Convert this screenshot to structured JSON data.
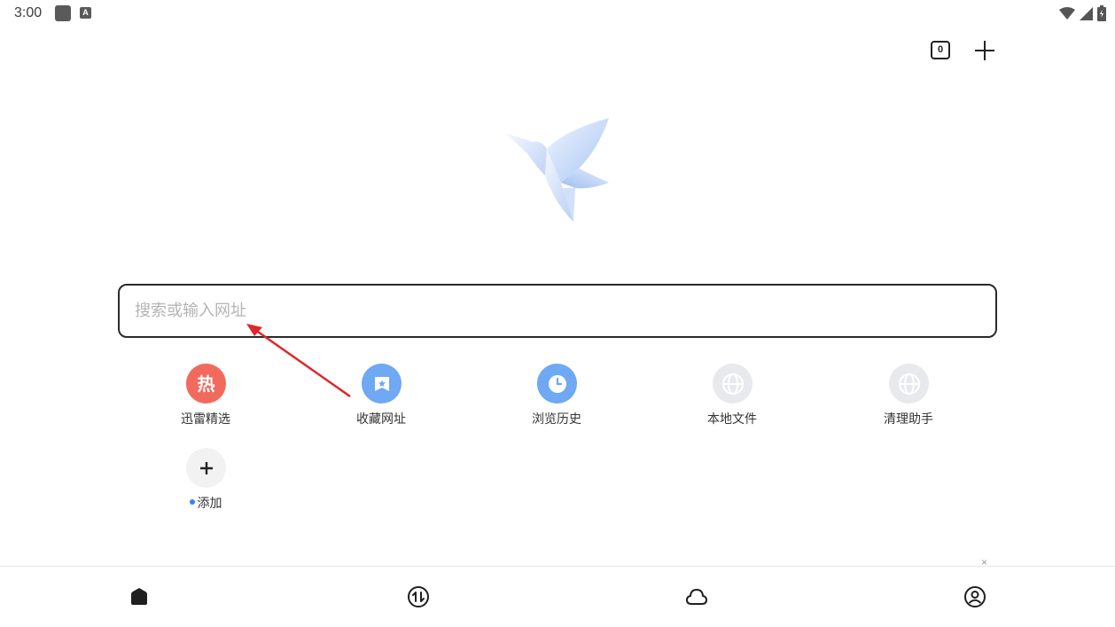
{
  "status_bar": {
    "time": "3:00",
    "notification_icon": "square-app-icon",
    "keyboard_badge": "A",
    "right_icons": [
      "wifi-icon",
      "cell-signal-icon",
      "battery-icon"
    ]
  },
  "toolbar": {
    "tab_count": "0",
    "new_tab_icon": "plus-icon"
  },
  "logo": {
    "icon": "hummingbird-logo-icon"
  },
  "search": {
    "placeholder": "搜索或输入网址",
    "value": ""
  },
  "shortcuts": [
    {
      "label": "迅雷精选",
      "icon": "hot-icon",
      "badge_text": "热",
      "color": "#f26a5e"
    },
    {
      "label": "收藏网址",
      "icon": "bookmark-star-icon",
      "color": "#5b9cf0"
    },
    {
      "label": "浏览历史",
      "icon": "clock-icon",
      "color": "#5b9cf0"
    },
    {
      "label": "本地文件",
      "icon": "globe-icon",
      "color": "#e8e9ec"
    },
    {
      "label": "清理助手",
      "icon": "globe-icon",
      "color": "#e8e9ec"
    }
  ],
  "add_shortcut": {
    "label": "添加",
    "icon": "plus-icon",
    "dot_color": "#3d7ff5"
  },
  "bottom_nav": {
    "close_glyph": "×",
    "items": [
      {
        "icon": "home-icon"
      },
      {
        "icon": "transfer-icon"
      },
      {
        "icon": "cloud-icon"
      },
      {
        "icon": "profile-icon"
      }
    ]
  }
}
